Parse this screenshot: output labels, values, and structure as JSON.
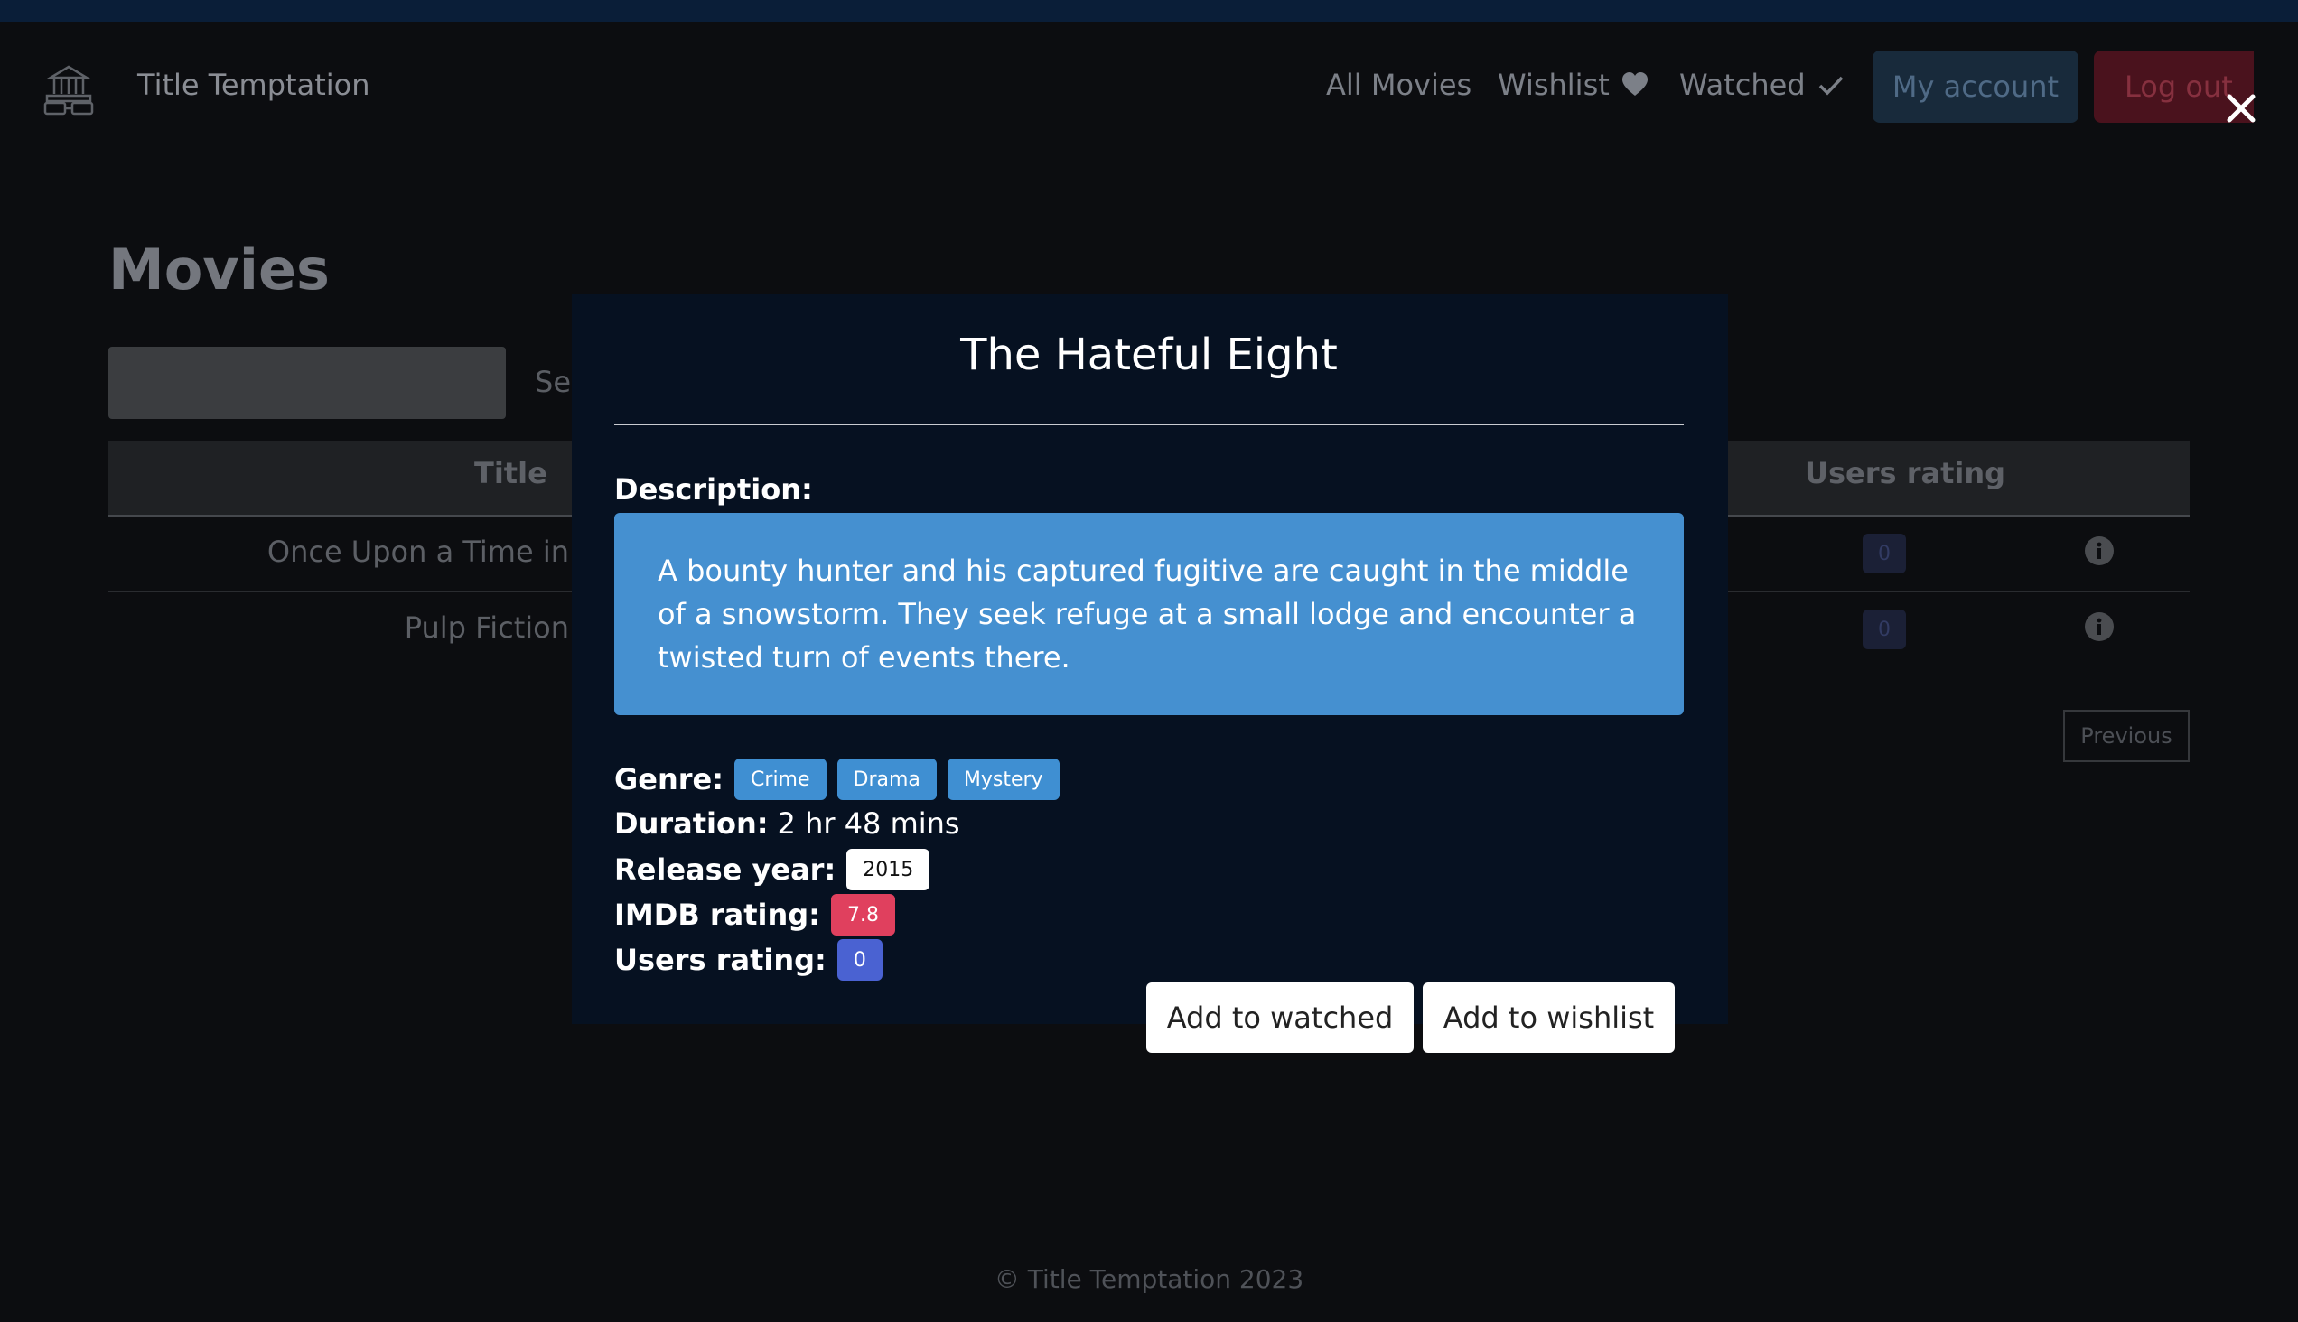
{
  "app": {
    "name": "Title Temptation"
  },
  "nav": {
    "all_movies": "All Movies",
    "wishlist": "Wishlist",
    "watched": "Watched",
    "my_account": "My account",
    "log_out": "Log out"
  },
  "page": {
    "title": "Movies",
    "search_button": "Search",
    "columns": {
      "title": "Title",
      "users_rating": "Users rating"
    },
    "rows": [
      {
        "title": "Once Upon a Time in",
        "users_rating": "0"
      },
      {
        "title": "Pulp Fiction",
        "users_rating": "0"
      }
    ],
    "previous": "Previous"
  },
  "footer": "© Title Temptation 2023",
  "modal": {
    "title": "The Hateful Eight",
    "description_label": "Description:",
    "description": "A bounty hunter and his captured fugitive are caught in the middle of a snowstorm. They seek refuge at a small lodge and encounter a twisted turn of events there.",
    "genre_label": "Genre:",
    "genres": [
      "Crime",
      "Drama",
      "Mystery"
    ],
    "duration_label": "Duration:",
    "duration": "2 hr 48 mins",
    "release_year_label": "Release year:",
    "release_year": "2015",
    "imdb_label": "IMDB rating:",
    "imdb_rating": "7.8",
    "users_label": "Users rating:",
    "users_rating": "0",
    "add_watched": "Add to watched",
    "add_wishlist": "Add to wishlist"
  },
  "colors": {
    "description_bg": "#4590d0",
    "genre_badge": "#3f8fd2",
    "imdb_badge": "#e0405e",
    "users_badge": "#4a62d2",
    "modal_bg": "#061121"
  },
  "icons": [
    "cinema-icon",
    "heart-icon",
    "check-icon",
    "close-icon",
    "info-icon"
  ]
}
